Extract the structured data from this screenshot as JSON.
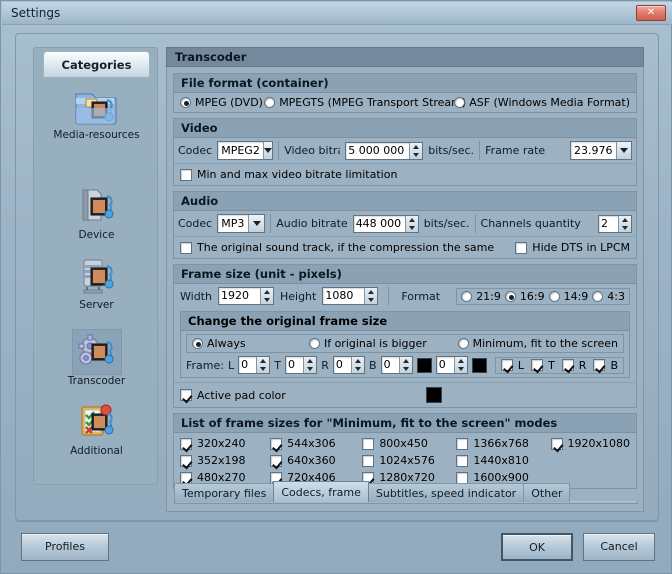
{
  "window": {
    "title": "Settings",
    "close_label": "✕"
  },
  "sidebar": {
    "tab_label": "Categories",
    "items": [
      {
        "label": "Media-resources",
        "icon": "folder-media-icon",
        "selected": false
      },
      {
        "label": "Device",
        "icon": "device-media-icon",
        "selected": false
      },
      {
        "label": "Server",
        "icon": "server-media-icon",
        "selected": false
      },
      {
        "label": "Transcoder",
        "icon": "gears-media-icon",
        "selected": true
      },
      {
        "label": "Additional",
        "icon": "clipboard-checklist-icon",
        "selected": false
      }
    ]
  },
  "pane": {
    "title": "Transcoder",
    "file_format": {
      "heading": "File format (container)",
      "options": [
        {
          "label": "MPEG (DVD)",
          "selected": true
        },
        {
          "label": "MPEGTS (MPEG Transport Stream)",
          "selected": false
        },
        {
          "label": "ASF (Windows Media Format)",
          "selected": false
        }
      ]
    },
    "video": {
      "heading": "Video",
      "codec_label": "Codec",
      "codec_value": "MPEG2",
      "bitrate_label": "Video bitrate",
      "bitrate_value": "5 000 000",
      "bitrate_units": "bits/sec.",
      "framerate_label": "Frame rate",
      "framerate_value": "23.976",
      "minmax_label": "Min and max video bitrate limitation",
      "minmax_checked": false
    },
    "audio": {
      "heading": "Audio",
      "codec_label": "Codec",
      "codec_value": "MP3",
      "bitrate_label": "Audio bitrate",
      "bitrate_value": "448 000",
      "bitrate_units": "bits/sec.",
      "channels_label": "Channels quantity",
      "channels_value": "2",
      "original_track_label": "The original sound track, if the compression the same",
      "original_track_checked": false,
      "hide_dts_label": "Hide DTS in LPCM",
      "hide_dts_checked": false
    },
    "frame_size": {
      "heading": "Frame size (unit - pixels)",
      "width_label": "Width",
      "width_value": "1920",
      "height_label": "Height",
      "height_value": "1080",
      "format_label": "Format",
      "format_options": [
        {
          "label": "21:9",
          "selected": false
        },
        {
          "label": "16:9",
          "selected": true
        },
        {
          "label": "14:9",
          "selected": false
        },
        {
          "label": "4:3",
          "selected": false
        }
      ],
      "change_heading": "Change the original frame size",
      "change_modes": [
        {
          "label": "Always",
          "selected": true
        },
        {
          "label": "If original is bigger",
          "selected": false
        },
        {
          "label": "Minimum, fit to the screen",
          "selected": false
        }
      ],
      "frame_label": "Frame:",
      "frame_inputs": [
        {
          "label": "L",
          "value": "0"
        },
        {
          "label": "T",
          "value": "0"
        },
        {
          "label": "R",
          "value": "0"
        },
        {
          "label": "B",
          "value": "0"
        }
      ],
      "frame_color_1": "#000000",
      "extra_input_value": "0",
      "frame_color_2": "#000000",
      "side_toggles": [
        {
          "label": "L",
          "checked": true
        },
        {
          "label": "T",
          "checked": true
        },
        {
          "label": "R",
          "checked": true
        },
        {
          "label": "B",
          "checked": true
        }
      ],
      "active_pad_label": "Active pad color",
      "active_pad_checked": true,
      "active_pad_color": "#000000"
    },
    "frame_list": {
      "heading": "List of frame sizes for \"Minimum, fit to the screen\" modes",
      "columns": [
        [
          {
            "label": "320x240",
            "checked": true
          },
          {
            "label": "352x198",
            "checked": true
          },
          {
            "label": "480x270",
            "checked": true
          }
        ],
        [
          {
            "label": "544x306",
            "checked": true
          },
          {
            "label": "640x360",
            "checked": true
          },
          {
            "label": "720x406",
            "checked": true
          }
        ],
        [
          {
            "label": "800x450",
            "checked": false
          },
          {
            "label": "1024x576",
            "checked": false
          },
          {
            "label": "1280x720",
            "checked": true
          }
        ],
        [
          {
            "label": "1366x768",
            "checked": false
          },
          {
            "label": "1440x810",
            "checked": false
          },
          {
            "label": "1600x900",
            "checked": false
          }
        ],
        [
          {
            "label": "1920x1080",
            "checked": true
          }
        ]
      ]
    },
    "tabs": [
      {
        "label": "Temporary files",
        "active": false
      },
      {
        "label": "Codecs, frame",
        "active": true
      },
      {
        "label": "Subtitles, speed indicator",
        "active": false
      },
      {
        "label": "Other",
        "active": false
      }
    ]
  },
  "footer": {
    "profiles_label": "Profiles",
    "ok_label": "OK",
    "cancel_label": "Cancel"
  },
  "colors": {
    "accent": "#74899b",
    "panel": "#9cb2c3",
    "close": "#cf5f4e"
  }
}
